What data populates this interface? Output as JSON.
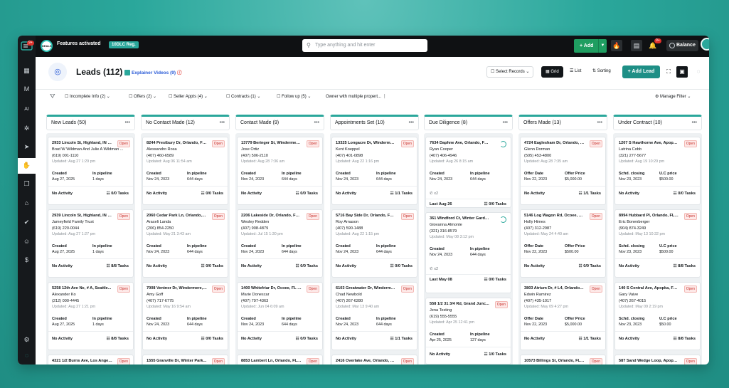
{
  "sidebar": {
    "badge": "9+",
    "items": [
      {
        "icon": "building-icon"
      },
      {
        "icon": "mail-icon"
      },
      {
        "icon": "ai-icon",
        "label": "AI"
      },
      {
        "icon": "settings-cog-icon"
      },
      {
        "icon": "megaphone-icon"
      },
      {
        "icon": "hand-icon"
      },
      {
        "icon": "copy-icon"
      },
      {
        "icon": "home-icon"
      },
      {
        "icon": "check-icon"
      },
      {
        "icon": "user-icon"
      },
      {
        "icon": "dollar-icon"
      },
      {
        "icon": "gear-icon"
      },
      {
        "icon": "spinner-icon"
      }
    ]
  },
  "topbar": {
    "features_ring_text": "DEALS",
    "features_label": "Features activated",
    "reg_label": "10DLC Reg.",
    "search_placeholder": "Type anything and hit enter",
    "add_label": "+ Add",
    "bell_badge": "9+",
    "balance_label": "Balance",
    "accent": "#2aa79b",
    "add_color": "#1f9e61"
  },
  "header": {
    "title": "Leads (112)",
    "explainer": "Explainer Videos (9)",
    "select_records": "Select Records",
    "grid": "Grid",
    "list": "List",
    "sorting": "Sorting",
    "add_lead": "+ Add Lead"
  },
  "filters": [
    {
      "label": "Incomplete Info (2)"
    },
    {
      "label": "Offers (2)"
    },
    {
      "label": "Seller Appts (4)"
    },
    {
      "label": "Contracts (1)"
    },
    {
      "label": "Follow up (5)"
    },
    {
      "label": "Owner with multiple propert..."
    }
  ],
  "manage_filter": "Manage Filter",
  "columns": [
    {
      "title": "New Leads (50)",
      "cards": [
        {
          "addr": "2933 Lincoln St, Highland, IN 4...",
          "owner": "Brad W Wildman And Julie A Wildman ...",
          "phone": "(619) 001-1110",
          "updated": "Updated: Aug 27 1:29 pm",
          "l1": "Created",
          "v1": "Aug 27, 2025",
          "l2": "In pipeline",
          "v2": "1 days",
          "activity": "No Activity",
          "tasks": "0/0 Tasks"
        },
        {
          "addr": "2939 Lincoln St, Highland, IN 4...",
          "owner": "Jameyfield Family Trust",
          "phone": "(619) 220-0044",
          "updated": "Updated: Aug 27 1:27 pm",
          "l1": "Created",
          "v1": "Aug 27, 2025",
          "l2": "In pipeline",
          "v2": "1 days",
          "activity": "No Activity",
          "tasks": "8/8 Tasks"
        },
        {
          "addr": "5258 12th Ave Ne, # A, Seattle...",
          "owner": "Alexander Ko",
          "phone": "(212) 000-4445",
          "updated": "Updated: Aug 27 1:21 pm",
          "l1": "Created",
          "v1": "Aug 27, 2025",
          "l2": "In pipeline",
          "v2": "1 days",
          "activity": "No Activity",
          "tasks": "8/8 Tasks"
        },
        {
          "addr": "4321 1/2 Burns Ave, Los Angel..."
        }
      ]
    },
    {
      "title": "No Contact Made (12)",
      "cards": [
        {
          "addr": "8244 Prestbury Dr, Orlando, FL...",
          "owner": "Alessandro Rosa",
          "phone": "(407) 460-6589",
          "updated": "Updated: Aug 06 11:54 am",
          "l1": "Created",
          "v1": "Nov 24, 2023",
          "l2": "In pipeline",
          "v2": "644 days",
          "activity": "No Activity",
          "tasks": "0/0 Tasks"
        },
        {
          "addr": "2060 Cedar Park Ln, Orlando, F...",
          "owner": "Araceli Landa",
          "phone": "(206) 854-2250",
          "updated": "Updated: May 21 3:43 am",
          "l1": "Created",
          "v1": "Nov 24, 2023",
          "l2": "In pipeline",
          "v2": "644 days",
          "activity": "No Activity",
          "tasks": "0/0 Tasks"
        },
        {
          "addr": "7008 Ventnor Dr, Windermere, ...",
          "owner": "Amy Goff",
          "phone": "(407) 717-6775",
          "updated": "Updated: May 16 9:54 am",
          "l1": "Created",
          "v1": "Nov 24, 2023",
          "l2": "In pipeline",
          "v2": "644 days",
          "activity": "No Activity",
          "tasks": "0/0 Tasks"
        },
        {
          "addr": "1555 Granville Dr, Winter Park..."
        }
      ]
    },
    {
      "title": "Contact Made (9)",
      "cards": [
        {
          "addr": "13779 Beringer St, Windermere...",
          "owner": "Jose Ortiz",
          "phone": "(407) 506-2110",
          "updated": "Updated: Aug 28 7:36 am",
          "l1": "Created",
          "v1": "Nov 24, 2023",
          "l2": "In pipeline",
          "v2": "644 days",
          "activity": "No Activity",
          "tasks": "0/0 Tasks"
        },
        {
          "addr": "2206 Lakeside Dr, Orlando, FL ...",
          "owner": "Wesley Redden",
          "phone": "(407) 908-4879",
          "updated": "Updated: Jul 15 1:30 pm",
          "l1": "Created",
          "v1": "Nov 24, 2023",
          "l2": "In pipeline",
          "v2": "644 days",
          "activity": "No Activity",
          "tasks": "0/0 Tasks"
        },
        {
          "addr": "1400 Whitefriar Dr, Ocoee, FL 3...",
          "owner": "Marie Donescar",
          "phone": "(407) 797-4363",
          "updated": "Updated: Jun 04 6:09 am",
          "l1": "Created",
          "v1": "Nov 24, 2023",
          "l2": "In pipeline",
          "v2": "644 days",
          "activity": "No Activity",
          "tasks": "0/0 Tasks"
        },
        {
          "addr": "8853 Lambert Ln, Orlando, FL ..."
        }
      ]
    },
    {
      "title": "Appointments Set (10)",
      "cards": [
        {
          "addr": "13325 Longacre Dr, Windermer...",
          "owner": "Kent Koeppel",
          "phone": "(407) 401-0898",
          "updated": "Updated: Aug 22 1:16 pm",
          "l1": "Created",
          "v1": "Nov 24, 2023",
          "l2": "In pipeline",
          "v2": "644 days",
          "activity": "No Activity",
          "tasks": "1/1 Tasks"
        },
        {
          "addr": "5716 Bay Side Dr, Orlando, FL 3...",
          "owner": "Roy Arnason",
          "phone": "(407) 590-1488",
          "updated": "Updated: Aug 22 1:15 pm",
          "l1": "Created",
          "v1": "Nov 24, 2023",
          "l2": "In pipeline",
          "v2": "644 days",
          "activity": "No Activity",
          "tasks": "0/0 Tasks"
        },
        {
          "addr": "6103 Greatwater Dr, Windermere...",
          "owner": "Chad Newbold",
          "phone": "(407) 267-6280",
          "updated": "Updated: Mar 13 9:40 am",
          "l1": "Created",
          "v1": "Nov 24, 2023",
          "l2": "In pipeline",
          "v2": "644 days",
          "activity": "No Activity",
          "tasks": "1/1 Tasks"
        },
        {
          "addr": "2416 Overlake Ave, Orlando, FL..."
        }
      ]
    },
    {
      "title": "Due Diligence (8)",
      "cards": [
        {
          "addr": "7634 Daphne Ave, Orlando, FL ...",
          "owner": "Ryan Cooper",
          "phone": "(407) 406-4946",
          "updated": "Updated: Aug 26 8:15 am",
          "l1": "Created",
          "v1": "Nov 24, 2023",
          "l2": "In pipeline",
          "v2": "644 days",
          "x2": "x2",
          "last": "Last Aug 26",
          "tasks": "0/0 Tasks"
        },
        {
          "addr": "361 Windford Ct, Winter Garde...",
          "owner": "Giovanna Almonte",
          "phone": "(321) 316-8579",
          "updated": "Updated: May 08 3:12 pm",
          "l1": "Created",
          "v1": "Nov 24, 2023",
          "l2": "In pipeline",
          "v2": "644 days",
          "x2": "x2",
          "last": "Last May 08",
          "tasks": "0/0 Tasks"
        },
        {
          "addr": "558 1/2 31 3/4 Rd, Grand Junc...",
          "owner": "Jena Testing",
          "phone": "(619) 555-5555",
          "updated": "Updated: Apr 25 12:41 pm",
          "l1": "Created",
          "v1": "Apr 25, 2025",
          "l2": "In pipeline",
          "v2": "127 days",
          "activity": "No Activity",
          "tasks": "1/0 Tasks"
        }
      ]
    },
    {
      "title": "Offers Made (13)",
      "cards": [
        {
          "addr": "4724 Eaglesham Dr, Orlando, F...",
          "owner": "Glenn Dorman",
          "phone": "(505) 453-4800",
          "updated": "Updated: Aug 28 7:35 am",
          "l1": "Offer Date",
          "v1": "Nov 22, 2023",
          "l2": "Offer Price",
          "v2": "$5,000.00",
          "activity": "No Activity",
          "tasks": "1/1 Tasks"
        },
        {
          "addr": "5146 Log Wagon Rd, Ocoee, FL ...",
          "owner": "Holly Himes",
          "phone": "(407) 312-2987",
          "updated": "Updated: May 24 4:40 am",
          "l1": "Offer Date",
          "v1": "Nov 22, 2023",
          "l2": "Offer Price",
          "v2": "$500.00",
          "activity": "No Activity",
          "tasks": "0/0 Tasks"
        },
        {
          "addr": "3803 Atrium Dr, # L4, Orlando, ...",
          "owner": "Edwin Ramirez",
          "phone": "(407) 435-1017",
          "updated": "Updated: May 09 4:27 pm",
          "l1": "Offer Date",
          "v1": "Nov 22, 2023",
          "l2": "Offer Price",
          "v2": "$5,000.00",
          "activity": "No Activity",
          "tasks": "1/1 Tasks"
        },
        {
          "addr": "10573 Billings St, Orlando, FL 3..."
        }
      ]
    },
    {
      "title": "Under Contract (10)",
      "cards": [
        {
          "addr": "1207 S Hawthorne Ave, Apopka...",
          "owner": "Latrina Cobb",
          "phone": "(321) 277-5677",
          "updated": "Updated: Aug 19 10:29 pm",
          "l1": "Schd. closing",
          "v1": "Nov 23, 2023",
          "l2": "U.C price",
          "v2": "$500.00",
          "activity": "No Activity",
          "tasks": "0/0 Tasks"
        },
        {
          "addr": "8994 Hubbard Pl, Orlando, FL 3...",
          "owner": "Eric Bonenberger",
          "phone": "(904) 874-3249",
          "updated": "Updated: May 13 10:32 pm",
          "l1": "Schd. closing",
          "v1": "Nov 23, 2023",
          "l2": "U.C price",
          "v2": "$500.00",
          "activity": "No Activity",
          "tasks": "8/8 Tasks"
        },
        {
          "addr": "140 S Central Ave, Apopka, FL ...",
          "owner": "Gary Vaive",
          "phone": "(407) 267-4015",
          "updated": "Updated: May 09 2:19 pm",
          "l1": "Schd. closing",
          "v1": "Nov 23, 2023",
          "l2": "U.C price",
          "v2": "$50.00",
          "activity": "No Activity",
          "tasks": "8/8 Tasks"
        },
        {
          "addr": "587 Sand Wedge Loop, Apopka..."
        }
      ]
    }
  ],
  "open_label": "Open"
}
